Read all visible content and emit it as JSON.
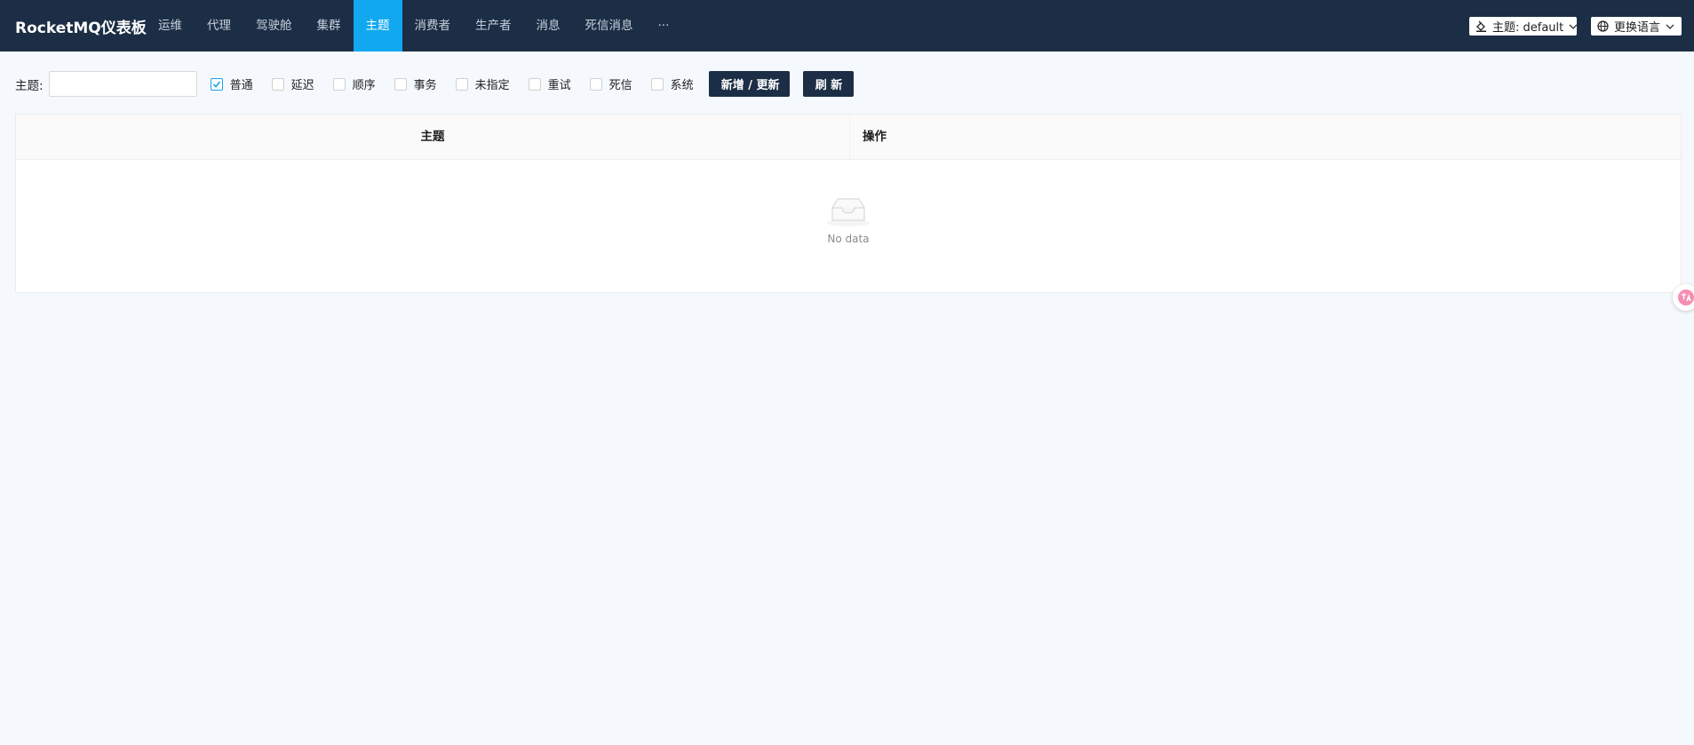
{
  "app": {
    "title": "RocketMQ仪表板"
  },
  "nav": {
    "items": [
      {
        "label": "运维"
      },
      {
        "label": "代理"
      },
      {
        "label": "驾驶舱"
      },
      {
        "label": "集群"
      },
      {
        "label": "主题"
      },
      {
        "label": "消费者"
      },
      {
        "label": "生产者"
      },
      {
        "label": "消息"
      },
      {
        "label": "死信消息"
      },
      {
        "label": "···"
      }
    ],
    "active": "主题"
  },
  "header": {
    "theme_select": "主题: default",
    "language_select": "更换语言"
  },
  "toolbar": {
    "topic_label": "主题:",
    "topic_input_value": "",
    "checkboxes": [
      {
        "label": "普通",
        "checked": true
      },
      {
        "label": "延迟",
        "checked": false
      },
      {
        "label": "顺序",
        "checked": false
      },
      {
        "label": "事务",
        "checked": false
      },
      {
        "label": "未指定",
        "checked": false
      },
      {
        "label": "重试",
        "checked": false
      },
      {
        "label": "死信",
        "checked": false
      },
      {
        "label": "系统",
        "checked": false
      }
    ],
    "add_update_label": "新增 / 更新",
    "refresh_label": "刷 新"
  },
  "table": {
    "columns": [
      "主题",
      "操作"
    ],
    "empty_text": "No data"
  },
  "colors": {
    "nav_bg": "#1c2e45",
    "accent": "#11a8f0",
    "page_bg": "#f5f9fd"
  }
}
